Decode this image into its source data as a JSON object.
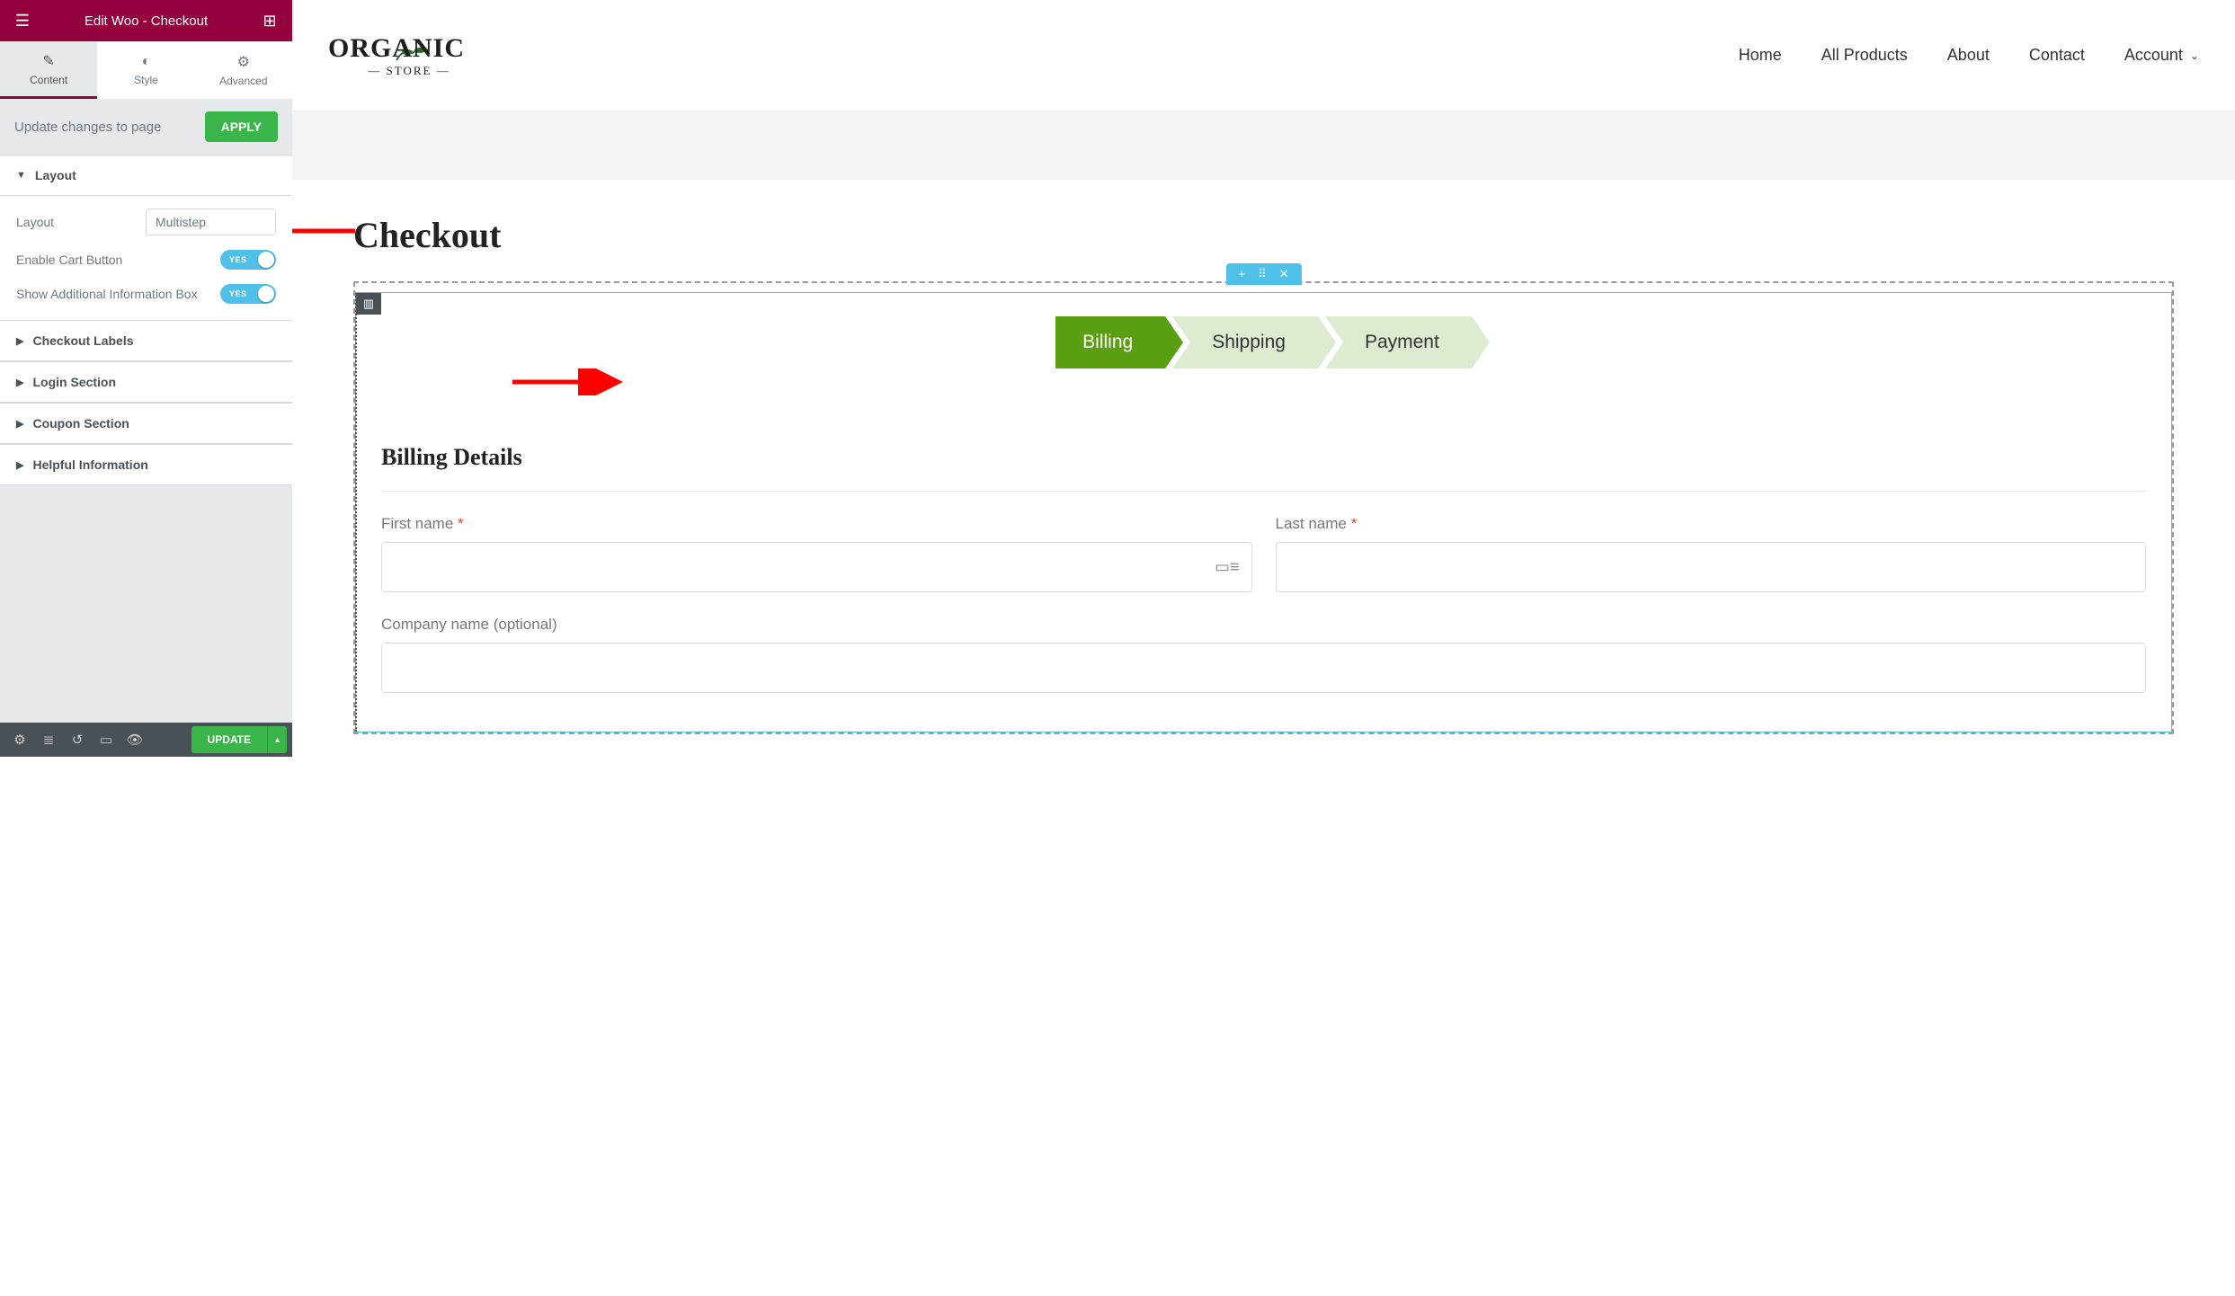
{
  "panel": {
    "title": "Edit Woo - Checkout",
    "tabs": {
      "content": "Content",
      "style": "Style",
      "advanced": "Advanced"
    },
    "apply_row": {
      "text": "Update changes to page",
      "button": "APPLY"
    },
    "layout": {
      "heading": "Layout",
      "layout_label": "Layout",
      "layout_value": "Multistep",
      "enable_cart": "Enable Cart Button",
      "show_info": "Show Additional Information Box",
      "toggle_yes": "YES"
    },
    "sections": {
      "checkout_labels": "Checkout Labels",
      "login_section": "Login Section",
      "coupon_section": "Coupon Section",
      "helpful_info": "Helpful Information"
    },
    "footer": {
      "update": "UPDATE"
    }
  },
  "site": {
    "logo_top": "ORGANIC",
    "logo_sub": "STORE",
    "nav": {
      "home": "Home",
      "products": "All Products",
      "about": "About",
      "contact": "Contact",
      "account": "Account"
    }
  },
  "page": {
    "title": "Checkout",
    "steps": {
      "billing": "Billing",
      "shipping": "Shipping",
      "payment": "Payment"
    },
    "billing": {
      "heading": "Billing Details",
      "first_name": "First name",
      "last_name": "Last name",
      "company": "Company name (optional)",
      "star": "*"
    }
  },
  "section_handle": {
    "plus": "+",
    "drag": "⠿",
    "close": "✕"
  }
}
